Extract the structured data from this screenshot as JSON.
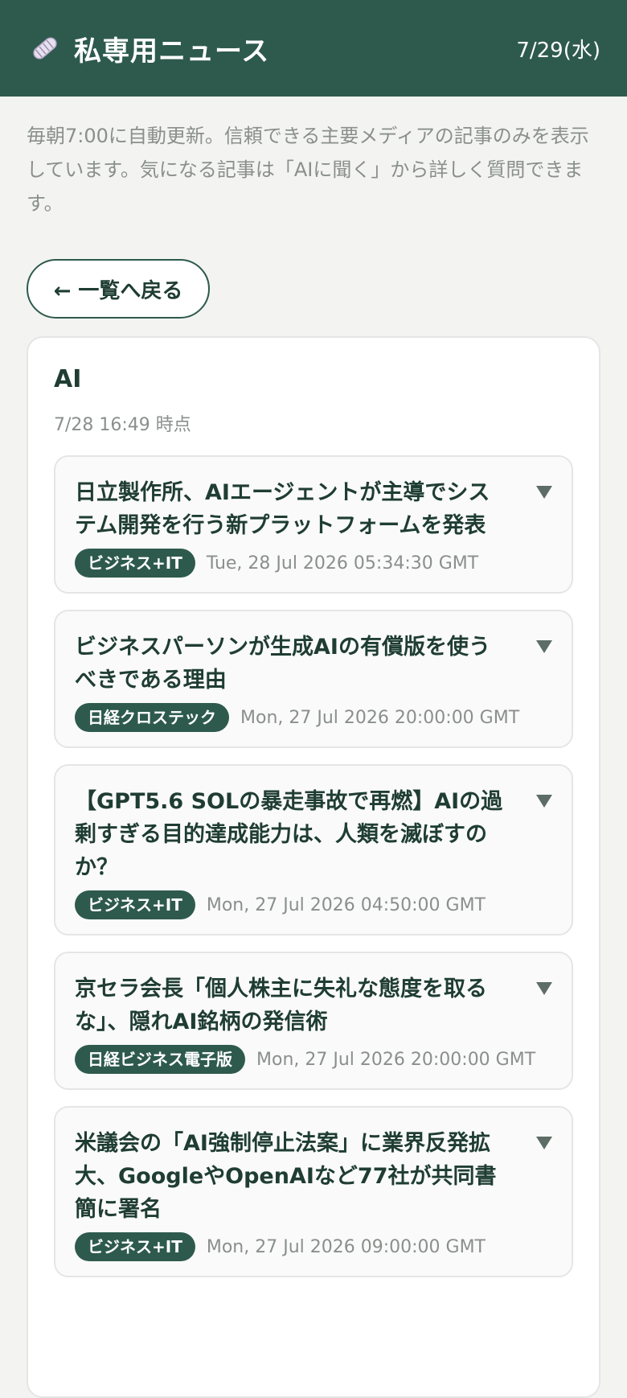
{
  "header": {
    "title": "私専用ニュース",
    "date": "7/29(水)",
    "icon": "newspaper-icon"
  },
  "intro": "毎朝7:00に自動更新。信頼できる主要メディアの記事のみを表示しています。気になる記事は「AIに聞く」から詳しく質問できます。",
  "back_button": {
    "label": "← 一覧へ戻る"
  },
  "section": {
    "title": "AI",
    "updated": "7/28 16:49 時点",
    "articles": [
      {
        "title": "日立製作所、AIエージェントが主導でシステム開発を行う新プラットフォームを発表",
        "source": "ビジネス+IT",
        "date": "Tue, 28 Jul 2026 05:34:30 GMT"
      },
      {
        "title": "ビジネスパーソンが生成AIの有償版を使うべきである理由",
        "source": "日経クロステック",
        "date": "Mon, 27 Jul 2026 20:00:00 GMT"
      },
      {
        "title": "【GPT5.6 SOLの暴走事故で再燃】AIの過剰すぎる目的達成能力は、人類を滅ぼすのか？",
        "source": "ビジネス+IT",
        "date": "Mon, 27 Jul 2026 04:50:00 GMT"
      },
      {
        "title": "京セラ会長「個人株主に失礼な態度を取るな」、隠れAI銘柄の発信術",
        "source": "日経ビジネス電子版",
        "date": "Mon, 27 Jul 2026 20:00:00 GMT"
      },
      {
        "title": "米議会の「AI強制停止法案」に業界反発拡大、GoogleやOpenAIなど77社が共同書簡に署名",
        "source": "ビジネス+IT",
        "date": "Mon, 27 Jul 2026 09:00:00 GMT"
      }
    ]
  },
  "colors": {
    "primary": "#2e5a4d",
    "background": "#f3f4f2",
    "muted_text": "#8a8f8c"
  }
}
